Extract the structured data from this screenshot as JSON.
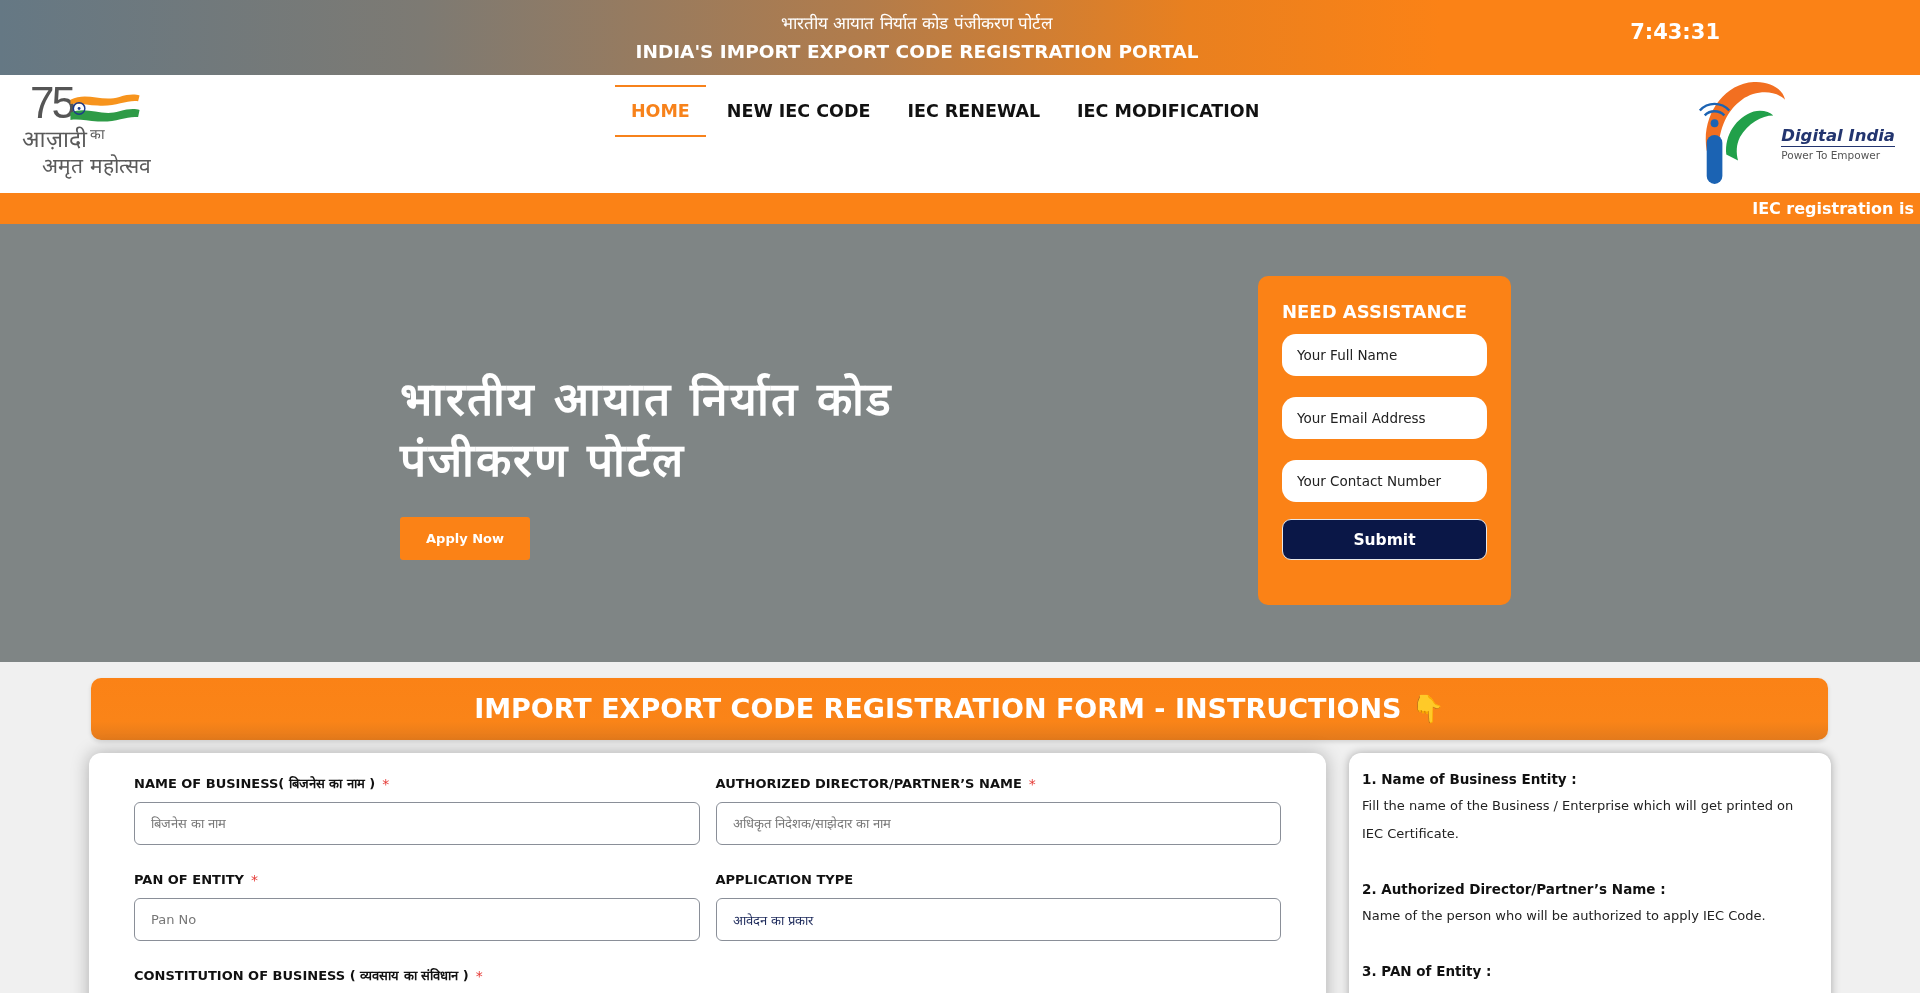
{
  "header": {
    "title_hindi": "भारतीय आयात निर्यात कोड पंजीकरण पोर्टल",
    "title": "INDIA'S IMPORT EXPORT CODE REGISTRATION PORTAL",
    "clock": "7:43:31"
  },
  "nav": {
    "logo": {
      "number": "75",
      "word": "आज़ादी",
      "small_word": "का",
      "line_2": "अमृत महोत्सव"
    },
    "items": [
      {
        "label": "HOME",
        "selected": true
      },
      {
        "label": "NEW IEC CODE",
        "selected": false
      },
      {
        "label": "IEC RENEWAL",
        "selected": false
      },
      {
        "label": "IEC MODIFICATION",
        "selected": false
      }
    ],
    "brand": {
      "name": "Digital India",
      "tagline": "Power To Empower"
    }
  },
  "ticker": {
    "text": "IEC registration is"
  },
  "hero": {
    "title": "भारतीय आयात निर्यात कोड पंजीकरण पोर्टल",
    "button": "Apply Now"
  },
  "assistance": {
    "title": "NEED ASSISTANCE",
    "fields": [
      {
        "placeholder": "Your Full Name"
      },
      {
        "placeholder": "Your Email Address"
      },
      {
        "placeholder": "Your Contact Number"
      }
    ],
    "button": "Submit"
  },
  "form": {
    "banner": "IMPORT EXPORT CODE REGISTRATION FORM - INSTRUCTIONS 👇",
    "fields": [
      {
        "label": "NAME OF BUSINESS( बिजनेस का नाम )",
        "mark": "*",
        "placeholder": "बिजनेस का नाम"
      },
      {
        "label": "AUTHORIZED DIRECTOR/PARTNER’S NAME",
        "mark": "*",
        "placeholder": "अधिकृत निदेशक/साझेदार का नाम"
      },
      {
        "label": "PAN OF ENTITY",
        "mark": "*",
        "placeholder": "Pan No"
      },
      {
        "label": "APPLICATION TYPE",
        "value": "आवेदन का प्रकार"
      },
      {
        "label": "CONSTITUTION OF BUSINESS ( व्यवसाय का संविधान )",
        "mark": "*"
      }
    ]
  },
  "instructions": [
    {
      "heading": "1. Name of Business Entity :",
      "text": "Fill the name of the Business / Enterprise which will get printed on IEC Certificate."
    },
    {
      "heading": "2. Authorized Director/Partner’s Name :",
      "text": "Name of the person who will be authorized to apply IEC Code."
    },
    {
      "heading": "3. PAN of Entity :"
    }
  ]
}
